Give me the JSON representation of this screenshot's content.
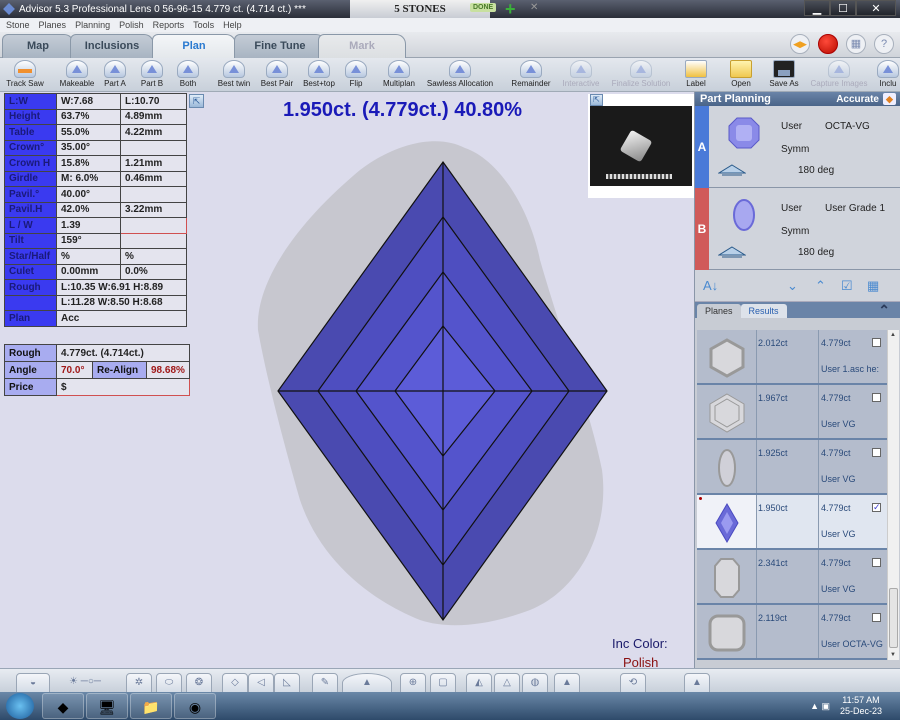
{
  "window": {
    "title": "Advisor 5.3 Professional    Lens 0    56-96-15    4.779 ct. (4.714 ct.) ***",
    "stones_tab": "5 STONES",
    "done_badge": "DONE",
    "controls": {
      "minimize": "▁",
      "maximize": "☐",
      "close": "✕"
    }
  },
  "menu": [
    "Stone",
    "Planes",
    "Planning",
    "Polish",
    "Reports",
    "Tools",
    "Help"
  ],
  "tabs": [
    {
      "label": "Map",
      "state": "normal"
    },
    {
      "label": "Inclusions",
      "state": "normal"
    },
    {
      "label": "Plan",
      "state": "active"
    },
    {
      "label": "Fine Tune",
      "state": "normal"
    },
    {
      "label": "Mark",
      "state": "disabled"
    }
  ],
  "toolbar": [
    {
      "label": "Track Saw",
      "icon": "saw-icon",
      "enabled": true
    },
    {
      "label": "Makeable",
      "icon": "makeable-icon",
      "enabled": true
    },
    {
      "label": "Part A",
      "icon": "part-a-icon",
      "enabled": true
    },
    {
      "label": "Part B",
      "icon": "part-b-icon",
      "enabled": true
    },
    {
      "label": "Both",
      "icon": "both-icon",
      "enabled": true
    },
    {
      "label": "Best twin",
      "icon": "best-twin-icon",
      "enabled": true
    },
    {
      "label": "Best Pair",
      "icon": "best-pair-icon",
      "enabled": true
    },
    {
      "label": "Best+top",
      "icon": "best-top-icon",
      "enabled": true
    },
    {
      "label": "Flip",
      "icon": "flip-icon",
      "enabled": true
    },
    {
      "label": "Multiplan",
      "icon": "multiplan-icon",
      "enabled": true
    },
    {
      "label": "Sawless Allocation",
      "icon": "sawless-icon",
      "enabled": true
    },
    {
      "label": "Remainder",
      "icon": "remainder-icon",
      "enabled": true
    },
    {
      "label": "Interactive",
      "icon": "interactive-icon",
      "enabled": false
    },
    {
      "label": "Finalize Solution",
      "icon": "finalize-icon",
      "enabled": false
    },
    {
      "label": "Label",
      "icon": "label-icon",
      "enabled": true
    },
    {
      "label": "Open",
      "icon": "folder-icon",
      "enabled": true
    },
    {
      "label": "Save As",
      "icon": "disk-icon",
      "enabled": true
    },
    {
      "label": "Capture Images",
      "icon": "camera-icon",
      "enabled": false
    },
    {
      "label": "Inclu",
      "icon": "inclusion-icon",
      "enabled": true
    }
  ],
  "params": [
    {
      "label": "L:W",
      "v1": "W:7.68",
      "v2": "L:10.70"
    },
    {
      "label": "Height",
      "v1": "63.7%",
      "v2": "4.89mm"
    },
    {
      "label": "Table",
      "v1": "55.0%",
      "v2": "4.22mm"
    },
    {
      "label": "Crown°",
      "v1": "35.00°",
      "v2": ""
    },
    {
      "label": "Crown H",
      "v1": "15.8%",
      "v2": "1.21mm"
    },
    {
      "label": "Girdle",
      "v1": "M: 6.0%",
      "v2": "0.46mm"
    },
    {
      "label": "Pavil.°",
      "v1": "40.00°",
      "v2": ""
    },
    {
      "label": "Pavil.H",
      "v1": "42.0%",
      "v2": "3.22mm"
    },
    {
      "label": "L / W",
      "v1": "1.39",
      "v2": ""
    },
    {
      "label": "Tilt",
      "v1": "159°",
      "v2": ""
    },
    {
      "label": "Star/Half",
      "v1": "%",
      "v2": "%"
    },
    {
      "label": "Culet",
      "v1": "0.00mm",
      "v2": "0.0%"
    },
    {
      "label": "Rough",
      "span": "L:10.35 W:6.91 H:8.89"
    },
    {
      "label": "",
      "span": "L:11.28 W:8.50 H:8.68"
    },
    {
      "label": "Plan",
      "span": "Acc"
    }
  ],
  "rough_info": {
    "rough_label": "Rough",
    "rough_value": "4.779ct. (4.714ct.)",
    "angle_label": "Angle",
    "angle_value": "70.0°",
    "realign_label": "Re-Align",
    "realign_value": "98.68%",
    "price_label": "Price",
    "price_value": "$"
  },
  "headline": "1.950ct. (4.779ct.) 40.80%",
  "inc_color_label": "Inc Color:",
  "polish_label": "Polish",
  "part_planning": {
    "title": "Part Planning",
    "mode": "Accurate",
    "parts": [
      {
        "letter": "A",
        "color": "#4a7ad8",
        "type": "User",
        "grade": "OCTA-VG",
        "symm": "Symm",
        "rotation": "180 deg"
      },
      {
        "letter": "B",
        "color": "#d05a5a",
        "type": "User",
        "grade": "User Grade 1",
        "symm": "Symm",
        "rotation": "180 deg"
      }
    ],
    "tabs": [
      {
        "label": "Planes",
        "active": false
      },
      {
        "label": "Results",
        "active": true
      }
    ]
  },
  "results": [
    {
      "weight": "2.012ct",
      "rough": "4.779ct",
      "desc": "User 1.asc he:",
      "checked": false,
      "shape": "hexagon"
    },
    {
      "weight": "1.967ct",
      "rough": "4.779ct",
      "desc": "User VG",
      "checked": false,
      "shape": "hexagon2"
    },
    {
      "weight": "1.925ct",
      "rough": "4.779ct",
      "desc": "User VG",
      "checked": false,
      "shape": "marquise"
    },
    {
      "weight": "1.950ct",
      "rough": "4.779ct",
      "desc": "User VG",
      "checked": true,
      "shape": "kite",
      "selected": true
    },
    {
      "weight": "2.341ct",
      "rough": "4.779ct",
      "desc": "User VG",
      "checked": false,
      "shape": "emerald"
    },
    {
      "weight": "2.119ct",
      "rough": "4.779ct",
      "desc": "User OCTA-VG",
      "checked": false,
      "shape": "cushion"
    }
  ],
  "taskbar": {
    "time": "11:57 AM",
    "date": "25-Dec-23"
  }
}
